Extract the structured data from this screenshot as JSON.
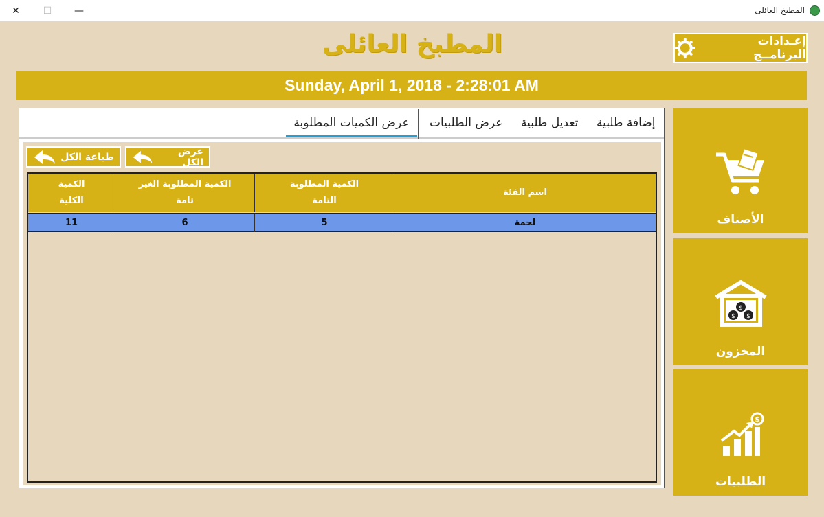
{
  "window": {
    "title": "المطبخ العائلى",
    "close_glyph": "✕",
    "max_glyph": "☐",
    "min_glyph": "—"
  },
  "header": {
    "title": "المطبخ العائلى",
    "settings_label": "إعـدادات البرنامــج",
    "datetime": "Sunday, April 1, 2018 - 2:28:01 AM"
  },
  "tabs": [
    {
      "label": "إضافة طلبية"
    },
    {
      "label": "تعديل طلبية"
    },
    {
      "label": "عرض الطلبيات"
    },
    {
      "label": "عرض الكميات المطلوبة",
      "active": true
    }
  ],
  "actions": {
    "show_all": "عرض الكل",
    "print_all": "طباعة الكل"
  },
  "table": {
    "columns": [
      "اسم الفئة",
      "الكمية المطلوبة التامة",
      "الكمية المطلوبة الغير تامة",
      "الكمية الكلية"
    ],
    "rows": [
      [
        "لحمة",
        "5",
        "6",
        "11"
      ]
    ]
  },
  "sidebar": {
    "items": [
      {
        "label": "الأصناف",
        "icon": "cart-icon"
      },
      {
        "label": "المخزون",
        "icon": "warehouse-icon"
      },
      {
        "label": "الطلبيات",
        "icon": "sales-chart-icon"
      }
    ]
  },
  "colors": {
    "accent": "#d7b216",
    "background": "#e7d7bd",
    "selected_row": "#6d97e8",
    "active_tab": "#1fa0d8"
  }
}
